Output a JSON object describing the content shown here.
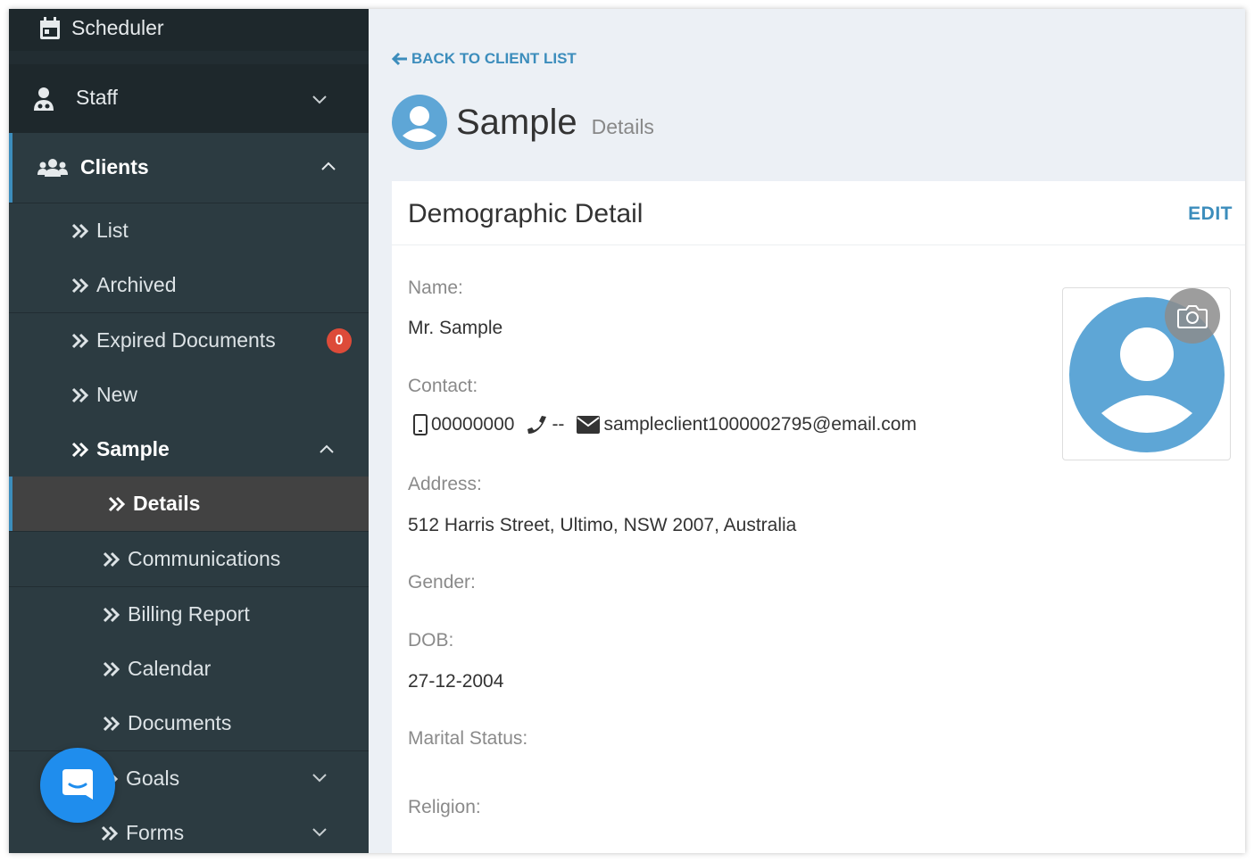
{
  "sidebar": {
    "scheduler_label": "Scheduler",
    "staff_label": "Staff",
    "clients_label": "Clients",
    "client_items": [
      {
        "label": "List"
      },
      {
        "label": "Archived"
      },
      {
        "label": "Expired Documents",
        "badge": "0"
      },
      {
        "label": "New"
      },
      {
        "label": "Sample"
      }
    ],
    "sample_items": [
      {
        "label": "Details"
      },
      {
        "label": "Communications"
      },
      {
        "label": "Billing Report"
      },
      {
        "label": "Calendar"
      },
      {
        "label": "Documents"
      },
      {
        "label": "Goals"
      },
      {
        "label": "Forms"
      }
    ]
  },
  "main": {
    "back_link": "BACK TO CLIENT LIST",
    "title": "Sample",
    "subtitle": "Details",
    "card": {
      "title": "Demographic Detail",
      "edit_label": "EDIT",
      "fields": {
        "name_label": "Name:",
        "name_value": "Mr. Sample",
        "contact_label": "Contact:",
        "mobile": "00000000",
        "phone": "--",
        "email": "sampleclient1000002795@email.com",
        "address_label": "Address:",
        "address_value": "512 Harris Street, Ultimo, NSW 2007, Australia",
        "gender_label": "Gender:",
        "dob_label": "DOB:",
        "dob_value": "27-12-2004",
        "marital_label": "Marital Status:",
        "religion_label": "Religion:"
      }
    }
  },
  "colors": {
    "sidebar_bg": "#222d32",
    "accent": "#3c8dbc",
    "badge": "#dd4b39",
    "avatar": "#5ea6d6",
    "chat": "#1f8ded"
  }
}
